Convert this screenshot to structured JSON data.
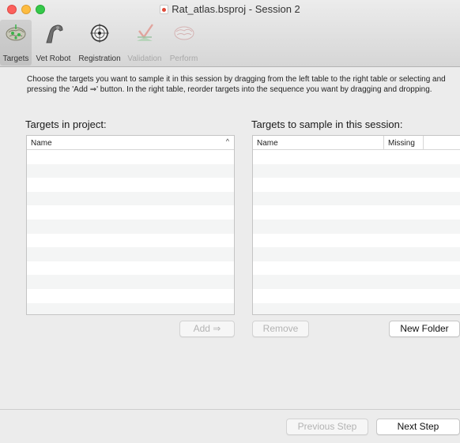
{
  "window": {
    "title": "Rat_atlas.bsproj - Session 2"
  },
  "toolbar": {
    "items": [
      {
        "label": "Targets",
        "icon": "brain-targets-icon",
        "selected": true,
        "enabled": true
      },
      {
        "label": "Vet Robot",
        "icon": "robot-arm-icon",
        "selected": false,
        "enabled": true
      },
      {
        "label": "Registration",
        "icon": "registration-target-icon",
        "selected": false,
        "enabled": true
      },
      {
        "label": "Validation",
        "icon": "validation-icon",
        "selected": false,
        "enabled": false
      },
      {
        "label": "Perform",
        "icon": "perform-brain-icon",
        "selected": false,
        "enabled": false
      }
    ]
  },
  "instructions": "Choose the targets you want to sample it in this session by dragging from the left table to the right table or selecting and pressing the 'Add ⇒' button. In the right table, reorder targets into the sequence you want by dragging and dropping.",
  "left_panel": {
    "title": "Targets in project:",
    "columns": [
      "Name"
    ],
    "sort_indicator": "^",
    "rows": []
  },
  "right_panel": {
    "title": "Targets to sample in this session:",
    "columns": [
      "Name",
      "Missing"
    ],
    "rows": []
  },
  "buttons": {
    "add": "Add ⇒",
    "remove": "Remove",
    "new_folder": "New Folder",
    "previous_step": "Previous Step",
    "next_step": "Next Step"
  },
  "colors": {
    "close": "#fc605c",
    "minimize": "#fdbc40",
    "maximize": "#34c84a",
    "row_stripe": "#f4f5f5"
  }
}
